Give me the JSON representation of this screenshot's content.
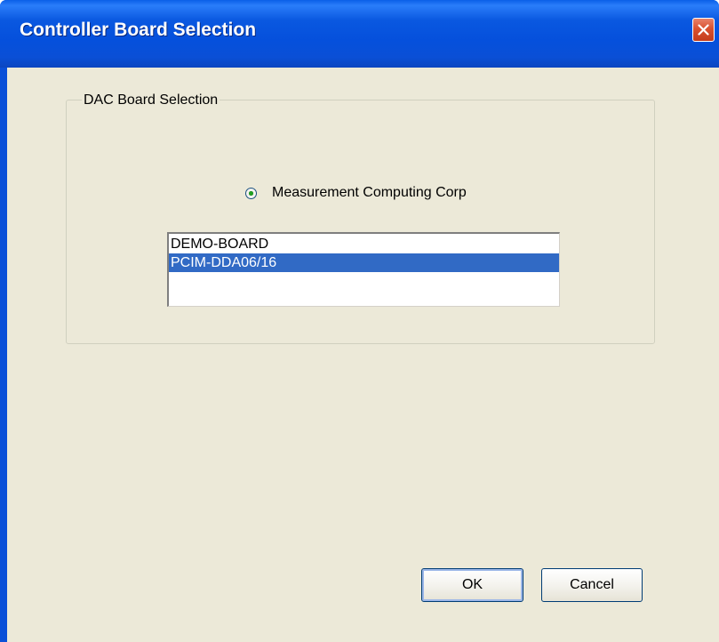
{
  "window": {
    "title": "Controller Board Selection",
    "close_icon": "close-icon"
  },
  "group": {
    "label": "DAC Board Selection"
  },
  "vendor_radio": {
    "label": "Measurement Computing Corp",
    "checked": true
  },
  "board_list": {
    "items": [
      "DEMO-BOARD",
      "PCIM-DDA06/16"
    ],
    "selected_index": 1
  },
  "buttons": {
    "ok_label": "OK",
    "cancel_label": "Cancel"
  },
  "colors": {
    "titlebar": "#0a58e0",
    "dialog_bg": "#ece9d8",
    "selection": "#316ac5",
    "close_button": "#d9512f"
  }
}
